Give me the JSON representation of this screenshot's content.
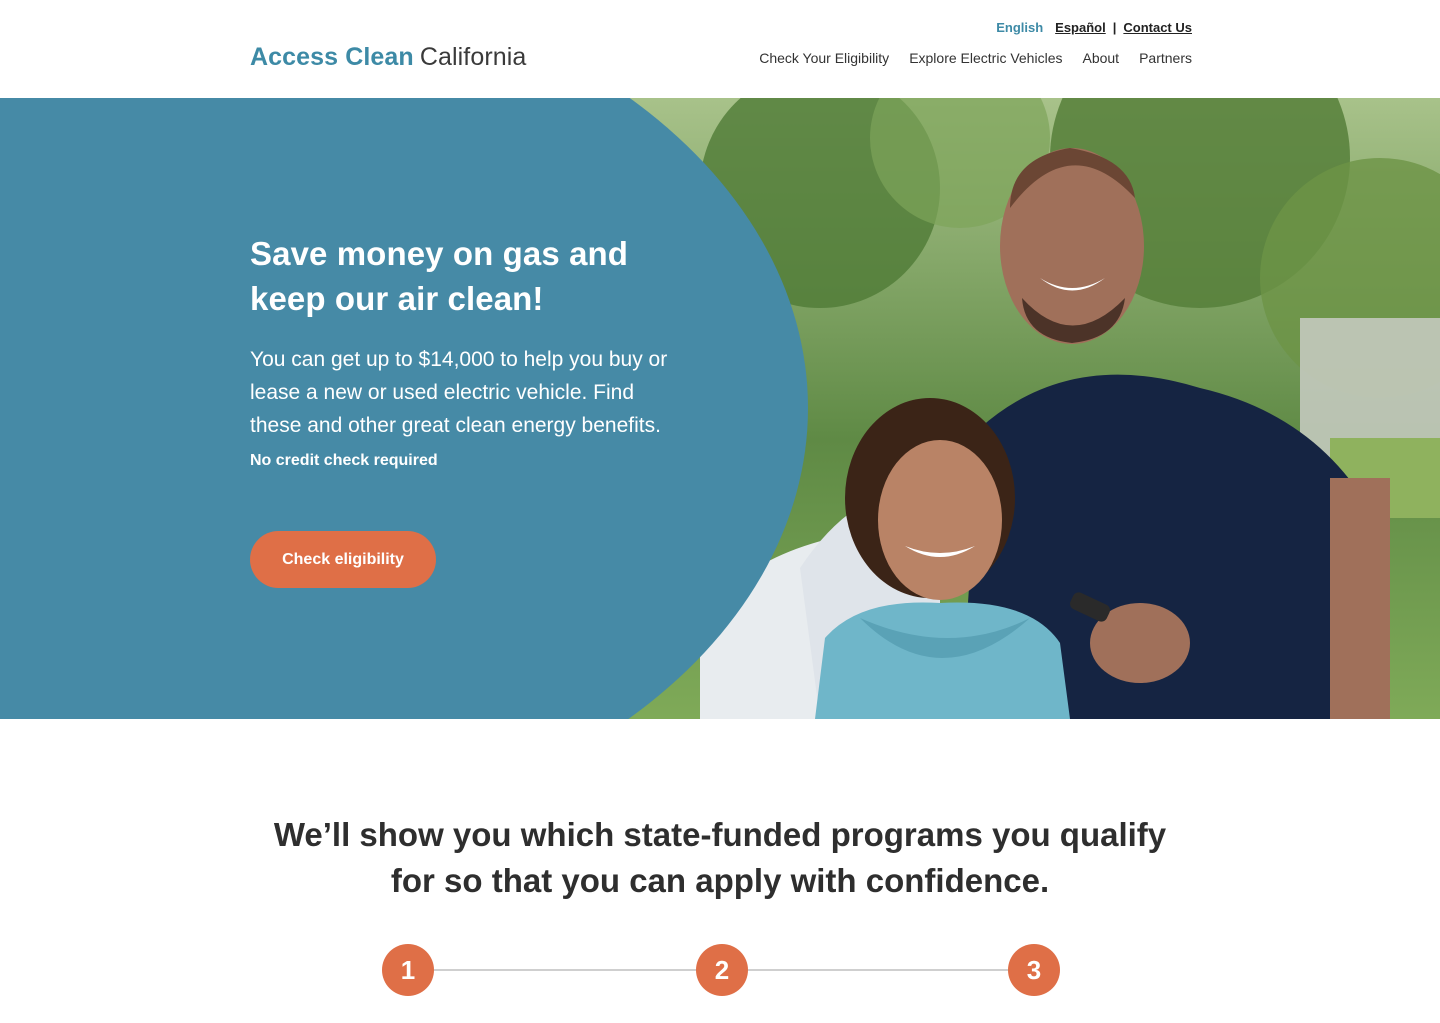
{
  "header": {
    "logo": {
      "strong": "Access Clean",
      "light": "California"
    },
    "utility": {
      "language_active": "English",
      "language_alt": "Español",
      "separator": "|",
      "contact": "Contact Us"
    },
    "nav": [
      "Check Your Eligibility",
      "Explore Electric Vehicles",
      "About",
      "Partners"
    ]
  },
  "hero": {
    "title": "Save money on gas and keep our air clean!",
    "body": "You can get up to $14,000 to help you buy or lease a new or used electric vehicle. Find these and other great clean energy benefits.",
    "note": "No credit check required",
    "cta": "Check eligibility"
  },
  "intro": "We’ll show you which state-funded programs you qualify for so that you can apply with confidence.",
  "steps": [
    "1",
    "2",
    "3"
  ],
  "colors": {
    "brand_blue": "#468aa6",
    "accent_orange": "#df6f47"
  }
}
